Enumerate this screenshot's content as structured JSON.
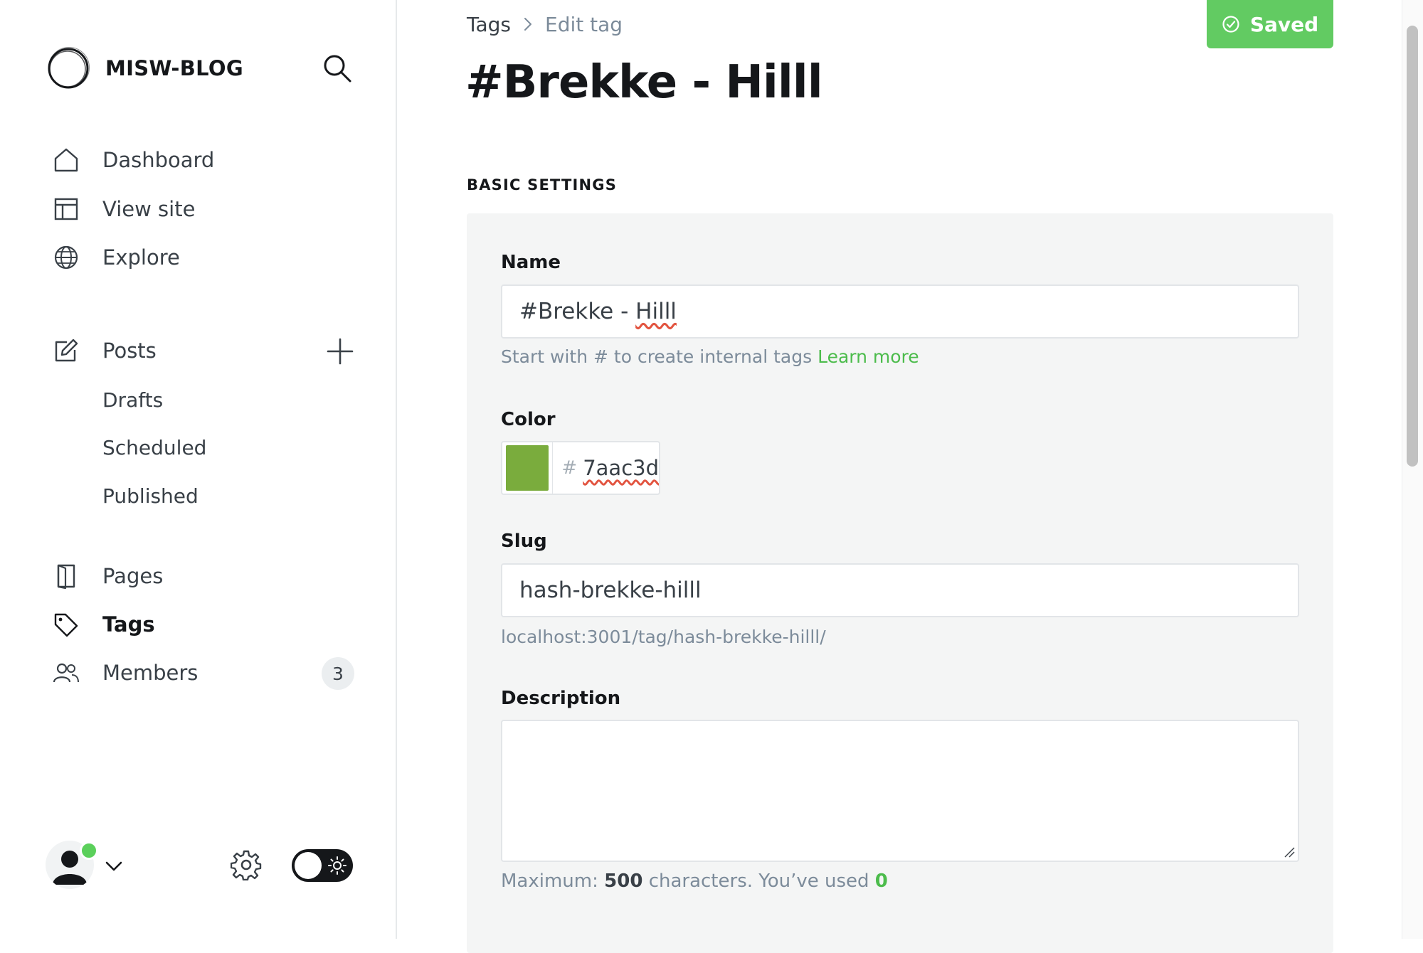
{
  "brand": {
    "name": "MISW-BLOG"
  },
  "sidebar": {
    "nav": [
      {
        "label": "Dashboard",
        "icon": "home-icon"
      },
      {
        "label": "View site",
        "icon": "layout-icon"
      },
      {
        "label": "Explore",
        "icon": "globe-icon"
      }
    ],
    "posts": {
      "label": "Posts",
      "icon": "edit-icon",
      "subitems": [
        "Drafts",
        "Scheduled",
        "Published"
      ]
    },
    "secondary": [
      {
        "label": "Pages",
        "icon": "page-icon"
      },
      {
        "label": "Tags",
        "icon": "tag-icon",
        "active": true
      },
      {
        "label": "Members",
        "icon": "members-icon",
        "count": "3"
      }
    ]
  },
  "header": {
    "breadcrumb": {
      "parent": "Tags",
      "current": "Edit tag"
    },
    "save_label": "Saved",
    "title": "#Brekke - Hilll"
  },
  "form": {
    "section_title": "BASIC SETTINGS",
    "name": {
      "label": "Name",
      "value": "#Brekke - Hilll",
      "hint": "Start with # to create internal tags",
      "hint_link": "Learn more"
    },
    "color": {
      "label": "Color",
      "hash": "#",
      "value": "7aac3d",
      "swatch": "#7aac3d"
    },
    "slug": {
      "label": "Slug",
      "value": "hash-brekke-hilll",
      "url_preview": "localhost:3001/tag/hash-brekke-hilll/"
    },
    "description": {
      "label": "Description",
      "value": "",
      "count_prefix": "Maximum:",
      "max": "500",
      "count_middle": "characters. You’ve used",
      "used": "0"
    }
  },
  "colors": {
    "accent_green": "#62cb62",
    "link_green": "#4cbc4c",
    "status_online": "#5bd05b"
  }
}
